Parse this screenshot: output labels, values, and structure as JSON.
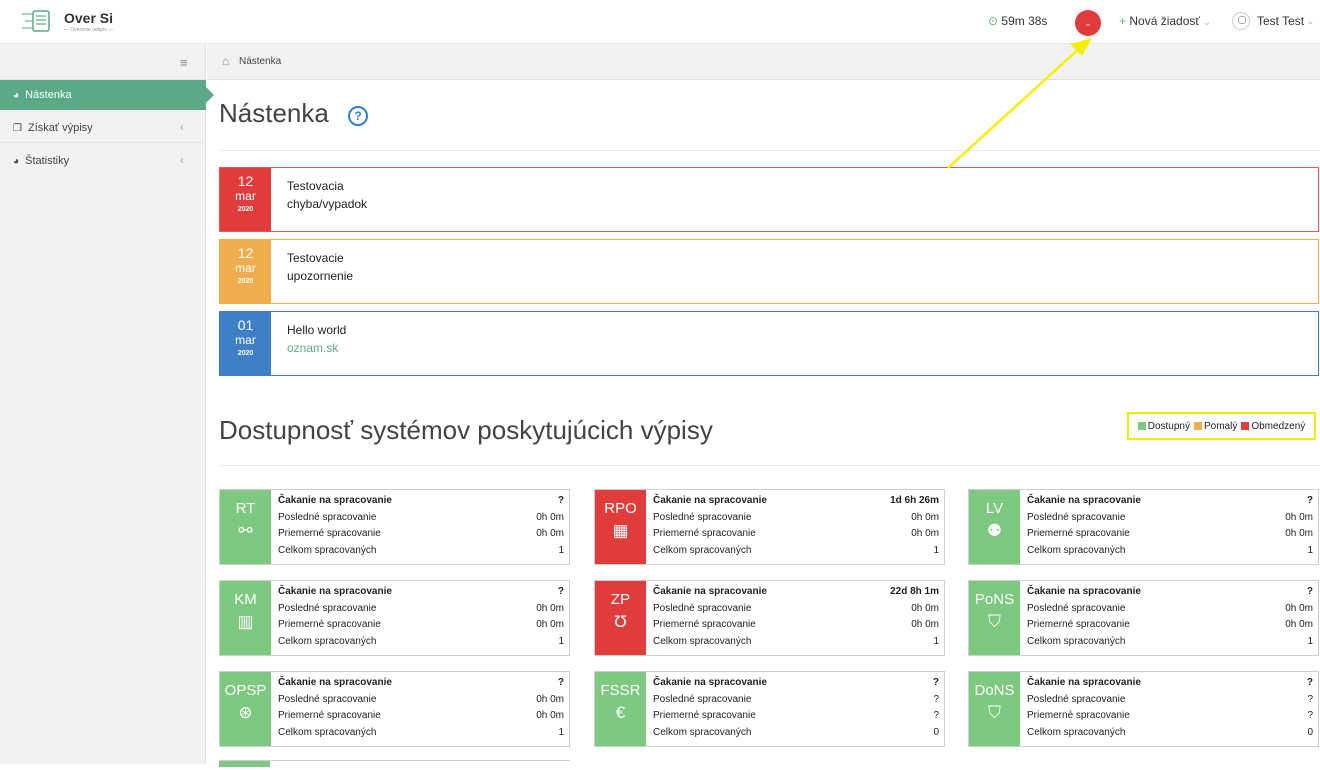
{
  "header": {
    "logo_title": "Over Si",
    "logo_subtitle": "— Overenie údajov —",
    "timer": "59m 38s",
    "new_request": "Nová žiadosť",
    "user_name": "Test Test"
  },
  "sidebar": {
    "items": [
      {
        "label": "Nástenka",
        "icon": "dashboard-icon"
      },
      {
        "label": "Získať výpisy",
        "icon": "copy-icon"
      },
      {
        "label": "Štatistiky",
        "icon": "stats-icon"
      }
    ]
  },
  "breadcrumb": {
    "label": "Nástenka"
  },
  "page": {
    "title": "Nástenka",
    "help": "?"
  },
  "notices": [
    {
      "day": "12",
      "month": "mar",
      "year": "2020",
      "line1": "Testovacia",
      "line2": "chyba/vypadok",
      "color": "#e03c3c"
    },
    {
      "day": "12",
      "month": "mar",
      "year": "2020",
      "line1": "Testovacie",
      "line2": "upozornenie",
      "color": "#f0ad4e"
    },
    {
      "day": "01",
      "month": "mar",
      "year": "2020",
      "line1": "Hello world",
      "line2": "oznam.sk",
      "color": "#3f7fc6"
    }
  ],
  "availability": {
    "title": "Dostupnosť systémov poskytujúcich výpisy",
    "legend": [
      {
        "label": "Dostupný",
        "color": "#7dc97f"
      },
      {
        "label": "Pomalý",
        "color": "#f0ad4e"
      },
      {
        "label": "Obmedzený",
        "color": "#e03c3c"
      }
    ]
  },
  "row_labels": {
    "waiting": "Čakanie na spracovanie",
    "last": "Posledné spracovanie",
    "average": "Priemerné spracovanie",
    "total": "Celkom spracovaných"
  },
  "cards": [
    {
      "code": "RT",
      "icon": "link-icon",
      "status": "green",
      "waiting": "?",
      "last": "0h 0m",
      "average": "0h 0m",
      "total": "1"
    },
    {
      "code": "RPO",
      "icon": "building-icon",
      "status": "red",
      "waiting": "1d 6h 26m",
      "last": "0h 0m",
      "average": "0h 0m",
      "total": "1"
    },
    {
      "code": "LV",
      "icon": "users-icon",
      "status": "green",
      "waiting": "?",
      "last": "0h 0m",
      "average": "0h 0m",
      "total": "1"
    },
    {
      "code": "KM",
      "icon": "map-icon",
      "status": "green",
      "waiting": "?",
      "last": "0h 0m",
      "average": "0h 0m",
      "total": "1"
    },
    {
      "code": "ZP",
      "icon": "stethoscope-icon",
      "status": "red",
      "waiting": "22d 8h 1m",
      "last": "0h 0m",
      "average": "0h 0m",
      "total": "1"
    },
    {
      "code": "PoNS",
      "icon": "graduation-cap-icon",
      "status": "green",
      "waiting": "?",
      "last": "0h 0m",
      "average": "0h 0m",
      "total": "1"
    },
    {
      "code": "OPSP",
      "icon": "accessibility-icon",
      "status": "green",
      "waiting": "?",
      "last": "0h 0m",
      "average": "0h 0m",
      "total": "1"
    },
    {
      "code": "FSSR",
      "icon": "euro-icon",
      "status": "red",
      "waiting": "?",
      "last": "?",
      "average": "?",
      "total": "0"
    },
    {
      "code": "DoNS",
      "icon": "graduation-cap-icon",
      "status": "green",
      "waiting": "?",
      "last": "?",
      "average": "?",
      "total": "0"
    }
  ]
}
